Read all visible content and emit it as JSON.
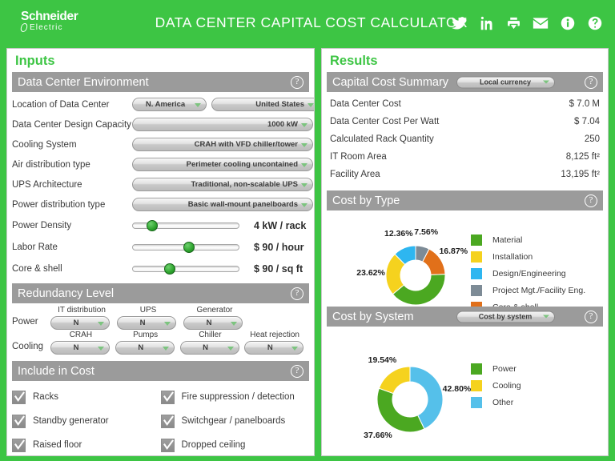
{
  "header": {
    "logo_name": "Schneider",
    "logo_sub": "Electric",
    "title": "DATA CENTER CAPITAL COST CALCULATOR",
    "icons": [
      {
        "name": "twitter-icon",
        "label": "Twitter"
      },
      {
        "name": "linkedin-icon",
        "label": "LinkedIn"
      },
      {
        "name": "print-icon",
        "label": "Print"
      },
      {
        "name": "email-icon",
        "label": "Email"
      },
      {
        "name": "info-icon",
        "label": "Info"
      },
      {
        "name": "help-icon",
        "label": "Help"
      }
    ],
    "brand_color": "#3dc544"
  },
  "inputs": {
    "title": "Inputs",
    "environment": {
      "section_title": "Data Center Environment",
      "help": "?",
      "rows": [
        {
          "label": "Location of Data Center",
          "value1": "N. America",
          "value2": "United States"
        },
        {
          "label": "Data Center Design Capacity",
          "value": "1000 kW"
        },
        {
          "label": "Cooling System",
          "value": "CRAH with VFD chiller/tower"
        },
        {
          "label": "Air distribution type",
          "value": "Perimeter cooling uncontained"
        },
        {
          "label": "UPS Architecture",
          "value": "Traditional, non-scalable UPS"
        },
        {
          "label": "Power distribution type",
          "value": "Basic wall-mount panelboards"
        }
      ],
      "sliders": [
        {
          "label": "Power Density",
          "value": "4 kW / rack",
          "position": 15
        },
        {
          "label": "Labor Rate",
          "value": "$ 90 / hour",
          "position": 53
        },
        {
          "label": "Core & shell",
          "value": "$ 90 / sq ft",
          "position": 33
        }
      ]
    },
    "redundancy": {
      "section_title": "Redundancy Level",
      "help": "?",
      "power_label": "Power",
      "cooling_label": "Cooling",
      "power_items": [
        {
          "caption": "IT distribution",
          "value": "N"
        },
        {
          "caption": "UPS",
          "value": "N"
        },
        {
          "caption": "Generator",
          "value": "N"
        }
      ],
      "cooling_items": [
        {
          "caption": "CRAH",
          "value": "N"
        },
        {
          "caption": "Pumps",
          "value": "N"
        },
        {
          "caption": "Chiller",
          "value": "N"
        },
        {
          "caption": "Heat rejection",
          "value": "N"
        }
      ]
    },
    "include_in_cost": {
      "section_title": "Include in Cost",
      "help": "?",
      "items": [
        {
          "label": "Racks",
          "checked": true
        },
        {
          "label": "Fire suppression / detection",
          "checked": true
        },
        {
          "label": "Standby generator",
          "checked": true
        },
        {
          "label": "Switchgear / panelboards",
          "checked": true
        },
        {
          "label": "Raised floor",
          "checked": true
        },
        {
          "label": "Dropped ceiling",
          "checked": true
        }
      ]
    }
  },
  "results": {
    "title": "Results",
    "summary": {
      "section_title": "Capital Cost Summary",
      "currency_selector": "Local currency",
      "help": "?",
      "rows": [
        {
          "key": "Data Center Cost",
          "value": "$ 7.0 M"
        },
        {
          "key": "Data Center Cost Per Watt",
          "value": "$ 7.04"
        },
        {
          "key": "Calculated Rack Quantity",
          "value": "250"
        },
        {
          "key": "IT Room Area",
          "value": "8,125 ft²"
        },
        {
          "key": "Facility Area",
          "value": "13,195 ft²"
        }
      ]
    },
    "cost_by_type": {
      "section_title": "Cost by Type",
      "help": "?"
    },
    "cost_by_system": {
      "section_title": "Cost by System",
      "selector": "Cost by system",
      "help": "?"
    }
  },
  "chart_data": [
    {
      "type": "pie",
      "title": "Cost by Type",
      "variant": "donut",
      "start_angle_deg": 0,
      "legend_position": "right",
      "categories": [
        "Material",
        "Installation",
        "Design/Engineering",
        "Project Mgt./Facility Eng.",
        "Core & shell"
      ],
      "values": [
        39.59,
        23.62,
        12.36,
        7.56,
        16.87
      ],
      "labels": [
        "39.59%",
        "23.62%",
        "12.36%",
        "7.56%",
        "16.87%"
      ],
      "colors": [
        "#4ba821",
        "#f5d21e",
        "#2eb6f0",
        "#7d8b96",
        "#e1701a"
      ],
      "draw_order": [
        {
          "name": "Project Mgt./Facility Eng.",
          "value": 7.56,
          "color": "#7d8b96"
        },
        {
          "name": "Core & shell",
          "value": 16.87,
          "color": "#e1701a"
        },
        {
          "name": "Material",
          "value": 39.59,
          "color": "#4ba821"
        },
        {
          "name": "Installation",
          "value": 23.62,
          "color": "#f5d21e"
        },
        {
          "name": "Design/Engineering",
          "value": 12.36,
          "color": "#2eb6f0"
        }
      ]
    },
    {
      "type": "pie",
      "title": "Cost by System",
      "variant": "donut",
      "start_angle_deg": 0,
      "legend_position": "right",
      "categories": [
        "Power",
        "Cooling",
        "Other"
      ],
      "values": [
        37.66,
        19.54,
        42.8
      ],
      "labels": [
        "37.66%",
        "19.54%",
        "42.80%"
      ],
      "colors": [
        "#4ba821",
        "#f5d21e",
        "#55c0ea"
      ],
      "draw_order": [
        {
          "name": "Other",
          "value": 42.8,
          "color": "#55c0ea"
        },
        {
          "name": "Power",
          "value": 37.66,
          "color": "#4ba821"
        },
        {
          "name": "Cooling",
          "value": 19.54,
          "color": "#f5d21e"
        }
      ]
    }
  ]
}
